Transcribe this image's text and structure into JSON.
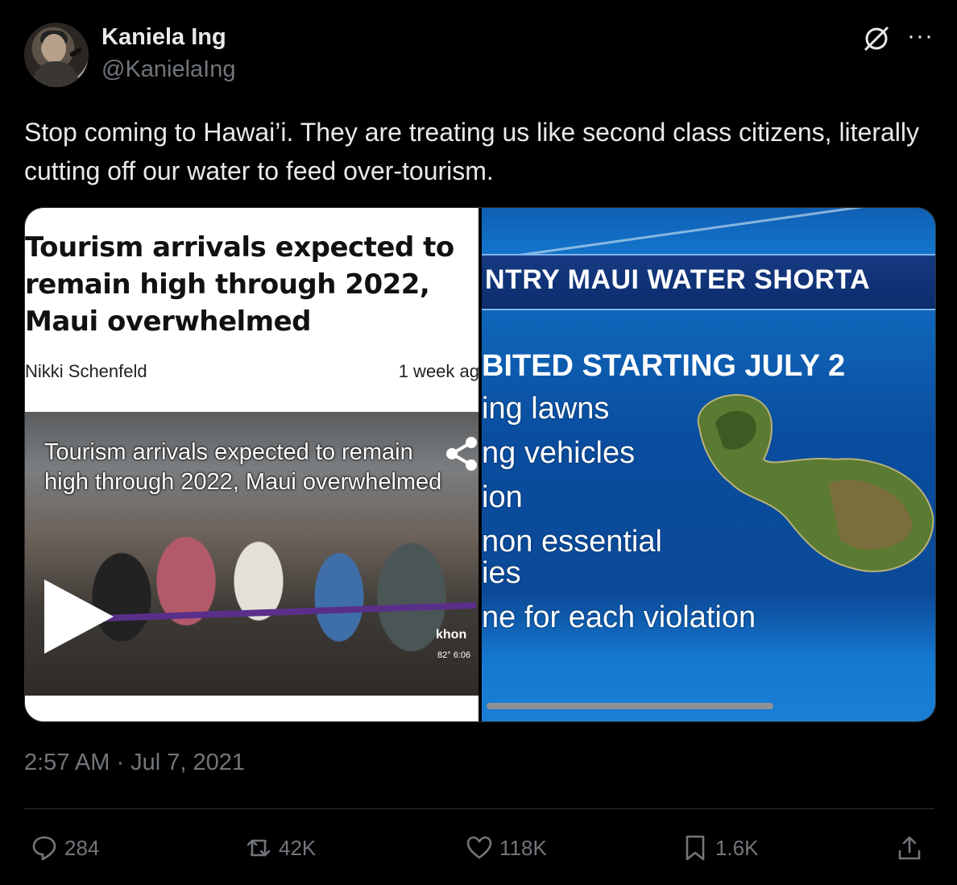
{
  "author": {
    "name": "Kaniela Ing",
    "handle": "@KanielaIng"
  },
  "tweet_text": "Stop coming to Hawai’i. They are treating us like second class citizens, literally cutting off our water to feed over-tourism.",
  "media": {
    "left": {
      "headline": "Tourism arrivals expected to remain high through 2022, Maui overwhelmed",
      "author": "Nikki Schenfeld",
      "age": "1 week ag",
      "video_caption": "Tourism arrivals expected to remain high through 2022, Maui overwhelmed",
      "station": "khon",
      "station_meta": "82°  6:06"
    },
    "right": {
      "banner": "NTRY MAUI WATER SHORTA",
      "prohibited": "BITED STARTING JULY 2",
      "items": [
        "ing lawns",
        "ng vehicles",
        "ion",
        "non essential",
        "ies",
        "ne for each violation"
      ]
    }
  },
  "timestamp": "2:57 AM · Jul 7, 2021",
  "stats": {
    "replies": "284",
    "reposts": "42K",
    "likes": "118K",
    "bookmarks": "1.6K"
  },
  "icons": [
    "grok-icon",
    "more-icon",
    "play-icon",
    "share-icon",
    "reply-icon",
    "repost-icon",
    "like-icon",
    "bookmark-icon",
    "share-upload-icon"
  ]
}
